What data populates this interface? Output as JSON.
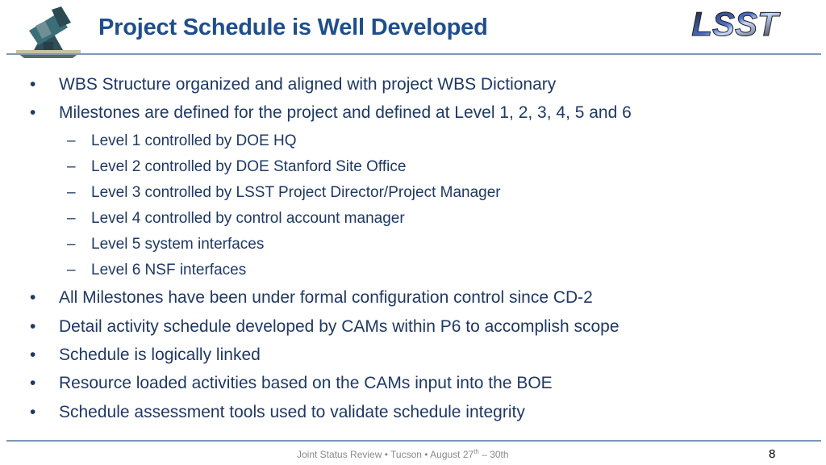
{
  "header": {
    "title": "Project Schedule is Well Developed",
    "logo_text": "LSST"
  },
  "bullets": [
    {
      "level": 1,
      "text": "WBS Structure organized and aligned with project WBS Dictionary"
    },
    {
      "level": 1,
      "text": "Milestones are defined for the project and defined at Level 1, 2, 3, 4, 5 and 6"
    },
    {
      "level": 2,
      "text": "Level 1 controlled by DOE HQ"
    },
    {
      "level": 2,
      "text": "Level 2 controlled by DOE Stanford Site Office"
    },
    {
      "level": 2,
      "text": "Level 3 controlled by LSST Project Director/Project Manager"
    },
    {
      "level": 2,
      "text": "Level 4 controlled by control account manager"
    },
    {
      "level": 2,
      "text": "Level 5 system interfaces"
    },
    {
      "level": 2,
      "text": "Level 6 NSF interfaces"
    },
    {
      "level": 1,
      "text": "All Milestones have been under formal configuration control since CD-2"
    },
    {
      "level": 1,
      "text": "Detail activity schedule developed by CAMs within P6 to accomplish scope"
    },
    {
      "level": 1,
      "text": "Schedule is logically linked"
    },
    {
      "level": 1,
      "text": "Resource loaded activities based on the CAMs input into the BOE"
    },
    {
      "level": 1,
      "text": "Schedule assessment tools used to validate schedule integrity"
    }
  ],
  "bullet_glyphs": {
    "level1": "•",
    "level2": "–"
  },
  "footer": {
    "text_before": "Joint Status Review • Tucson  • August 27",
    "superscript": "th",
    "text_after": " – 30th",
    "page_number": "8"
  },
  "colors": {
    "title": "#1f4e8c",
    "body_text": "#1f3864",
    "rule": "#7f97b7",
    "footer_text": "#8a8a8a"
  }
}
